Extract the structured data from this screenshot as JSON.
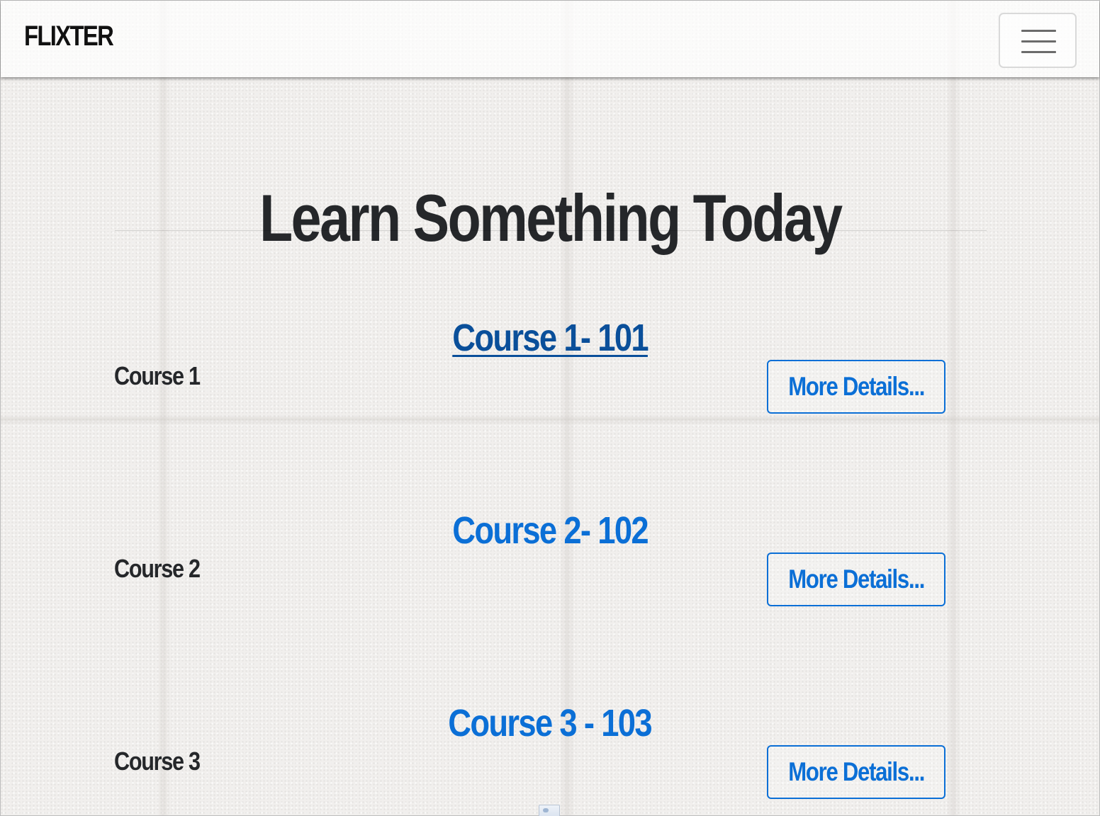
{
  "navbar": {
    "brand": "FLIXTER",
    "toggler_icon": "hamburger-menu-icon"
  },
  "hero": {
    "title": "Learn Something Today"
  },
  "courses": [
    {
      "title": "Course 1- 101",
      "label": "Course 1",
      "button": "More Details..."
    },
    {
      "title": "Course 2- 102",
      "label": "Course 2",
      "button": "More Details..."
    },
    {
      "title": "Course 3 - 103",
      "label": "Course 3",
      "button": "More Details..."
    }
  ],
  "colors": {
    "link": "#0b6fd6",
    "link_visited": "#0a4f9a",
    "heading": "#25272a",
    "background": "#f1efed"
  },
  "footer": {
    "image_icon": "broken-image-icon"
  }
}
